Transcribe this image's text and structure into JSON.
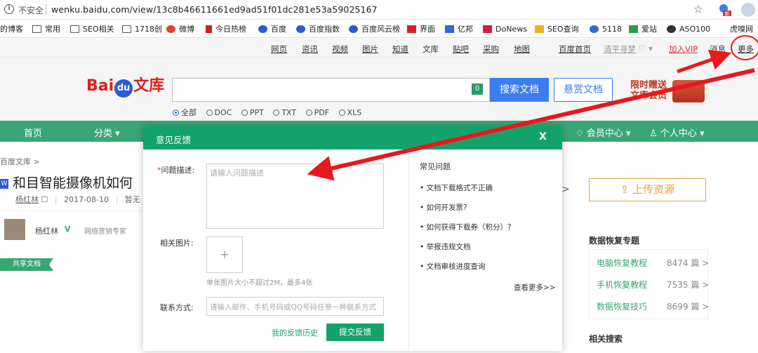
{
  "browser": {
    "security": "不安全",
    "url": "wenku.baidu.com/view/13c8b46611661ed9ad51f01dc281e53a59025167",
    "ext_badge": "新"
  },
  "bookmarks": [
    "的博客",
    "常用",
    "SEO相关",
    "1718创",
    "微博",
    "今日热榜",
    "百度",
    "百度指数",
    "百度风云榜",
    "界面",
    "亿邦",
    "DoNews",
    "SEO查询",
    "5118",
    "爱站",
    "ASO100",
    "虎嗅网"
  ],
  "topnav": {
    "links": [
      "网页",
      "资讯",
      "视频",
      "图片",
      "知道",
      "文库",
      "贴吧",
      "采购",
      "地图"
    ],
    "home": "百度首页",
    "user": "清平寻梦",
    "vip": "加入VIP",
    "msg": "消息",
    "more": "更多"
  },
  "logo": {
    "bai": "Bai",
    "du": "du",
    "wenku": "文库"
  },
  "search": {
    "count": "0",
    "search_btn": "搜索文档",
    "reward_btn": "悬赏文档",
    "promo_line1": "限时赠送",
    "promo_line2": "文库会员",
    "types": [
      "全部",
      "DOC",
      "PPT",
      "TXT",
      "PDF",
      "XLS"
    ]
  },
  "greennav": {
    "home": "首页",
    "category": "分类",
    "member": "会员中心",
    "personal": "个人中心"
  },
  "page": {
    "breadcrumb": "百度文库 >",
    "title": "和目智能摄像机如何",
    "author": "杨红林",
    "date": "2017-08-10",
    "meta_tail": "暂无",
    "author_name": "杨红林",
    "author_v": "V",
    "author_tag": "网络营销专家",
    "share_tag": "共享文档"
  },
  "sidebar": {
    "upload": "上传资源",
    "topic_title": "数据恢复专题",
    "topics": [
      {
        "label": "电脑恢复教程",
        "count": "8474 篇 >"
      },
      {
        "label": "手机恢复教程",
        "count": "7535 篇 >"
      },
      {
        "label": "数据恢复技巧",
        "count": "8699 篇 >"
      }
    ],
    "related": "相关搜索"
  },
  "modal": {
    "title": "意见反馈",
    "close": "X",
    "desc_label": "问题描述:",
    "desc_placeholder": "请输入问题描述",
    "img_label": "相关图片:",
    "upload_plus": "+",
    "img_hint": "单张图片大小不超过2M，最多4张",
    "contact_label": "联系方式:",
    "contact_placeholder": "请输入邮件、手机号码或QQ号码任意一种联系方式",
    "history": "我的反馈历史",
    "submit": "提交反馈",
    "faq_title": "常见问题",
    "faq": [
      "文档下载格式不正确",
      "如何开发票?",
      "如何获得下载券（积分）?",
      "举报违规文档",
      "文档审核进度查询"
    ],
    "faq_more": "查看更多>>"
  },
  "colors": {
    "green": "#13a36a",
    "baidu_blue": "#3b7cf0",
    "annotation_red": "#e8181e"
  }
}
